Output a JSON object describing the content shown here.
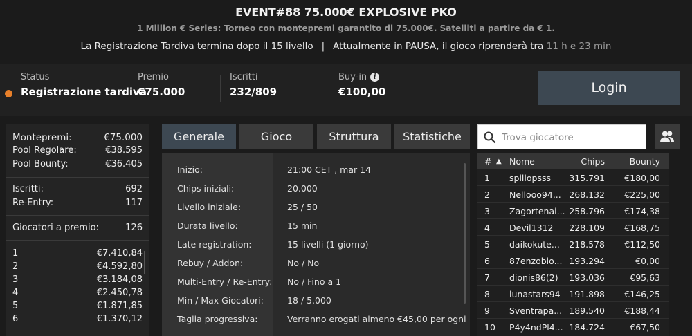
{
  "header": {
    "title": "EVENT#88 75.000€ EXPLOSIVE PKO",
    "subtitle": "1 Million € Series: Torneo  con montepremi garantito di 75.000€. Satelliti a partire da € 1.",
    "late_reg_text": "La Registrazione Tardiva termina dopo il 15 livello",
    "separator": "|",
    "status_text": "Attualmente in PAUSA, il gioco riprenderà tra",
    "time_left": "11 h e 23 min"
  },
  "infobar": {
    "status_label": "Status",
    "status_value": "Registrazione tardiva",
    "status_color": "#e8802a",
    "prize_label": "Premio",
    "prize_value": "€75.000",
    "entrants_label": "Iscritti",
    "entrants_value": "232/809",
    "buyin_label": "Buy-in",
    "buyin_value": "€100,00",
    "login_label": "Login"
  },
  "left_panel": {
    "prize_pool_label": "Montepremi:",
    "prize_pool_value": "€75.000",
    "regular_pool_label": "Pool Regolare:",
    "regular_pool_value": "€38.595",
    "bounty_pool_label": "Pool Bounty:",
    "bounty_pool_value": "€36.405",
    "entrants_label": "Iscritti:",
    "entrants_value": "692",
    "reentry_label": "Re-Entry:",
    "reentry_value": "117",
    "paid_label": "Giocatori a premio:",
    "paid_value": "126",
    "payouts": [
      {
        "pos": "1",
        "amount": "€7.410,84"
      },
      {
        "pos": "2",
        "amount": "€4.592,80"
      },
      {
        "pos": "3",
        "amount": "€3.184,08"
      },
      {
        "pos": "4",
        "amount": "€2.450,78"
      },
      {
        "pos": "5",
        "amount": "€1.871,85"
      },
      {
        "pos": "6",
        "amount": "€1.370,12"
      }
    ]
  },
  "tabs": [
    {
      "label": "Generale"
    },
    {
      "label": "Gioco"
    },
    {
      "label": "Struttura"
    },
    {
      "label": "Statistiche"
    }
  ],
  "general": [
    {
      "label": "Inizio:",
      "value": "21:00 CET , mar 14"
    },
    {
      "label": "Chips iniziali:",
      "value": "20.000"
    },
    {
      "label": "Livello iniziale:",
      "value": "25 / 50"
    },
    {
      "label": "Durata livello:",
      "value": "15 min"
    },
    {
      "label": "Late registration:",
      "value": "15 livelli (1 giorno)"
    },
    {
      "label": "Rebuy / Addon:",
      "value": "No / No"
    },
    {
      "label": "Multi-Entry / Re-Entry:",
      "value": "No / Fino a 1"
    },
    {
      "label": "Min / Max Giocatori:",
      "value": "18 / 5.000"
    },
    {
      "label": "Taglia progressiva:",
      "value": "Verranno erogati almeno €45,00 per ogni"
    }
  ],
  "search": {
    "placeholder": "Trova giocatore"
  },
  "players": {
    "headers": {
      "rank": "#",
      "sort_arrow": "▲",
      "name": "Nome",
      "chips": "Chips",
      "bounty": "Bounty"
    },
    "rows": [
      {
        "rank": "1",
        "name": "spillopsss",
        "chips": "315.791",
        "bounty": "€180,00"
      },
      {
        "rank": "2",
        "name": "Nellooo94...",
        "chips": "268.132",
        "bounty": "€225,00"
      },
      {
        "rank": "3",
        "name": "Zagortenai...",
        "chips": "258.796",
        "bounty": "€174,38"
      },
      {
        "rank": "4",
        "name": "Devil1312",
        "chips": "228.109",
        "bounty": "€168,75"
      },
      {
        "rank": "5",
        "name": "daikokute...",
        "chips": "218.578",
        "bounty": "€112,50"
      },
      {
        "rank": "6",
        "name": "87enzobio...",
        "chips": "193.294",
        "bounty": "€0,00"
      },
      {
        "rank": "7",
        "name": "dionis86(2)",
        "chips": "193.036",
        "bounty": "€95,63"
      },
      {
        "rank": "8",
        "name": "lunastars94",
        "chips": "191.898",
        "bounty": "€146,25"
      },
      {
        "rank": "9",
        "name": "Sventrapa...",
        "chips": "189.540",
        "bounty": "€188,44"
      },
      {
        "rank": "10",
        "name": "P4y4ndPl4...",
        "chips": "184.724",
        "bounty": "€67,50"
      }
    ]
  }
}
